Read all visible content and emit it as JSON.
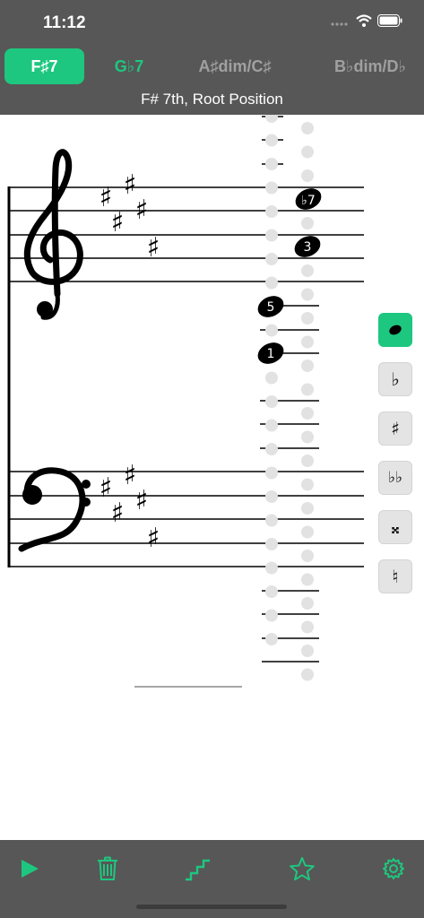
{
  "status": {
    "time": "11:12"
  },
  "tabs": [
    {
      "label": "F♯7"
    },
    {
      "label": "G♭7"
    },
    {
      "label": "A♯dim/C♯"
    },
    {
      "label": "B♭dim/D♭"
    }
  ],
  "subtitle": "F# 7th, Root Position",
  "notes": {
    "labels": [
      "♭7",
      "3",
      "5",
      "1"
    ]
  },
  "side_buttons": [
    {
      "name": "note-head-button",
      "label": ""
    },
    {
      "name": "flat-button",
      "label": "♭"
    },
    {
      "name": "sharp-button",
      "label": "♯"
    },
    {
      "name": "double-flat-button",
      "label": "♭♭"
    },
    {
      "name": "double-sharp-button",
      "label": "𝄪"
    },
    {
      "name": "natural-button",
      "label": "♮"
    }
  ],
  "toolbar": {
    "icons": [
      "play-icon",
      "trash-icon",
      "steps-icon",
      "star-icon",
      "gear-icon"
    ]
  },
  "colors": {
    "accent": "#1dc77f",
    "bar": "#575757",
    "inactive_tab": "#a0a0a0"
  }
}
